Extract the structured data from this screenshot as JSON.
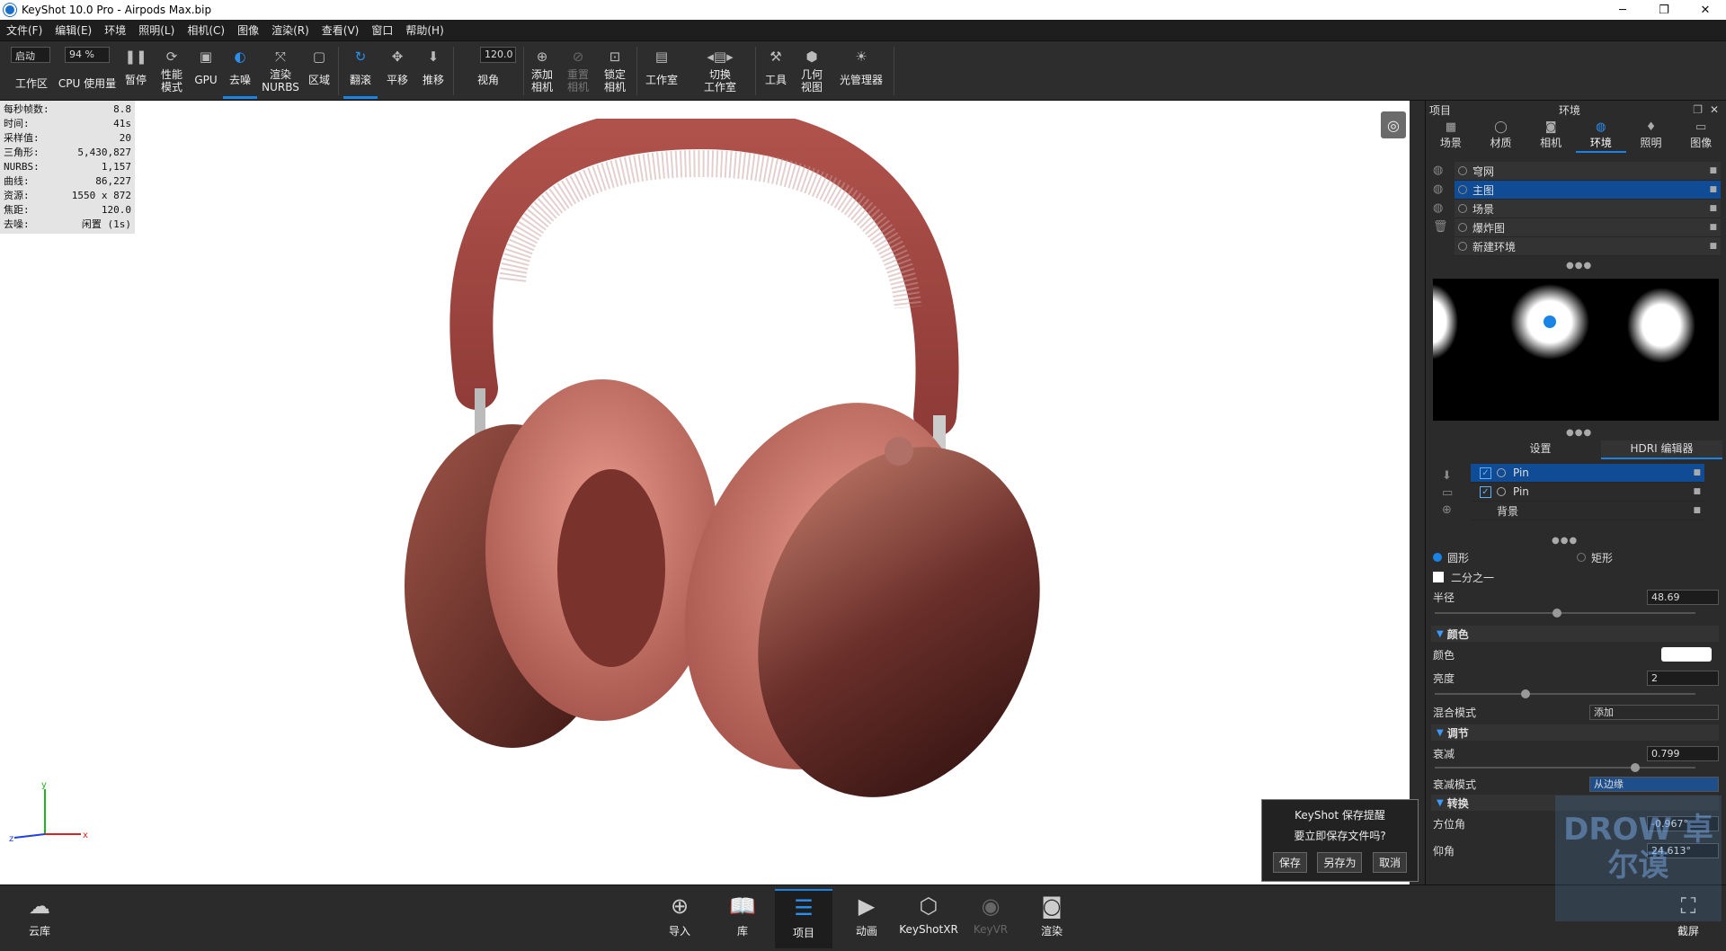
{
  "title": {
    "app": "KeyShot 10.0 Pro",
    "file": "Airpods Max.bip"
  },
  "window_controls": {
    "minimize": "─",
    "maximize": "❐",
    "close": "✕"
  },
  "menu": [
    "文件(F)",
    "编辑(E)",
    "环境",
    "照明(L)",
    "相机(C)",
    "图像",
    "渲染(R)",
    "查看(V)",
    "窗口",
    "帮助(H)"
  ],
  "toolbar": {
    "mode_select": "启动",
    "zoom_select": "94 %",
    "workspace": "工作区",
    "cpu_usage": "CPU 使用量",
    "pause": "暂停",
    "perf_mode": "性能\n模式",
    "gpu": "GPU",
    "denoise": "去噪",
    "render_nurbs": "渲染\nNURBS",
    "region": "区域",
    "tumble": "翻滚",
    "pan": "平移",
    "dolly": "推移",
    "fov_value": "120.0",
    "view_angle": "视角",
    "add_camera": "添加\n相机",
    "reset_camera": "重置\n相机",
    "lock_camera": "锁定\n相机",
    "studio": "工作室",
    "switch_studio": "切换\n工作室",
    "tools": "工具",
    "geometry_view": "几何\n视图",
    "light_manager": "光管理器"
  },
  "stats": [
    {
      "k": "每秒帧数:",
      "v": "8.8"
    },
    {
      "k": "时间:",
      "v": "41s"
    },
    {
      "k": "采样值:",
      "v": "20"
    },
    {
      "k": "三角形:",
      "v": "5,430,827"
    },
    {
      "k": "NURBS:",
      "v": "1,157"
    },
    {
      "k": "曲线:",
      "v": "86,227"
    },
    {
      "k": "资源:",
      "v": "1550 x 872"
    },
    {
      "k": "焦距:",
      "v": "120.0"
    },
    {
      "k": "去噪:",
      "v": "闲置 (1s)"
    }
  ],
  "axes": {
    "x": "x",
    "y": "y",
    "z": "z"
  },
  "save_dialog": {
    "title": "KeyShot 保存提醒",
    "question": "要立即保存文件吗?",
    "save": "保存",
    "save_as": "另存为",
    "cancel": "取消"
  },
  "panel": {
    "left_title": "项目",
    "center_title": "环境",
    "tabs": [
      "场景",
      "材质",
      "相机",
      "环境",
      "照明",
      "图像"
    ],
    "environments": [
      {
        "name": "穹网",
        "selected": false
      },
      {
        "name": "主图",
        "selected": true
      },
      {
        "name": "场景",
        "selected": false
      },
      {
        "name": "爆炸图",
        "selected": false
      },
      {
        "name": "新建环境",
        "selected": false
      }
    ],
    "subtabs": [
      "设置",
      "HDRI 编辑器"
    ],
    "pins": [
      {
        "name": "Pin",
        "selected": true
      },
      {
        "name": "Pin",
        "selected": false
      },
      {
        "name": "背景",
        "selected": false
      }
    ],
    "shape_circle": "圆形",
    "shape_rect": "矩形",
    "half": "二分之一",
    "radius_label": "半径",
    "radius_value": "48.69",
    "radius_level": 0.45,
    "color_section": "颜色",
    "color_label": "颜色",
    "color_value": "#ffffff",
    "brightness_label": "亮度",
    "brightness_value": "2",
    "brightness_level": 0.33,
    "blend_label": "混合模式",
    "blend_value": "添加",
    "adjust_section": "调节",
    "falloff_label": "衰减",
    "falloff_value": "0.799",
    "falloff_level": 0.75,
    "falloff_mode_label": "衰减模式",
    "falloff_mode_value": "从边缘",
    "transform_section": "转换",
    "azimuth_label": "方位角",
    "azimuth_value": "-0.967°",
    "elevation_label": "仰角",
    "elevation_value": "24.613°"
  },
  "bottom": {
    "cloud": "云库",
    "import": "导入",
    "library": "库",
    "project": "项目",
    "animation": "动画",
    "keyshotxr": "KeyShotXR",
    "keyvr": "KeyVR",
    "render": "渲染",
    "screenshot": "截屏"
  },
  "watermark": "DROW 卓尔谟"
}
